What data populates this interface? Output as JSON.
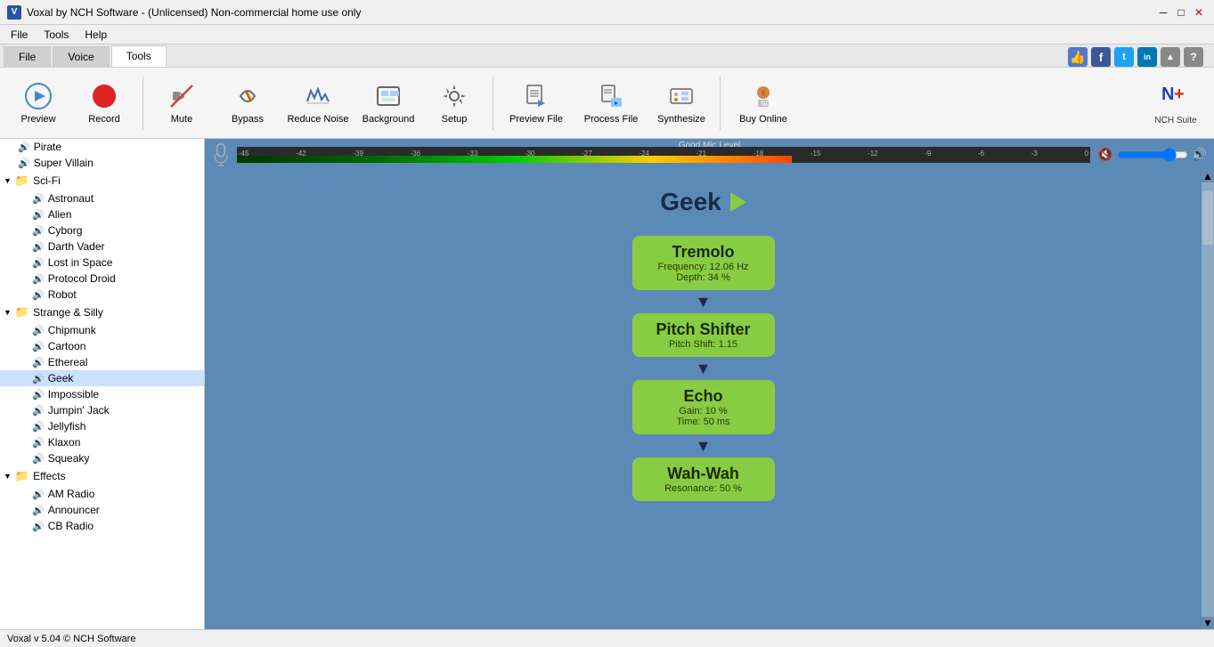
{
  "titlebar": {
    "icon_text": "V",
    "title": "Voxal by NCH Software - (Unlicensed) Non-commercial home use only",
    "btn_minimize": "─",
    "btn_maximize": "□",
    "btn_close": "✕"
  },
  "menubar": {
    "items": [
      "File",
      "Tools",
      "Help"
    ]
  },
  "tabs": {
    "items": [
      {
        "label": "File",
        "active": false
      },
      {
        "label": "Voice",
        "active": false
      },
      {
        "label": "Tools",
        "active": true
      }
    ]
  },
  "toolbar": {
    "buttons": [
      {
        "name": "preview",
        "label": "Preview"
      },
      {
        "name": "record",
        "label": "Record"
      },
      {
        "name": "mute",
        "label": "Mute"
      },
      {
        "name": "bypass",
        "label": "Bypass"
      },
      {
        "name": "reduce-noise",
        "label": "Reduce Noise"
      },
      {
        "name": "background",
        "label": "Background"
      },
      {
        "name": "setup",
        "label": "Setup"
      },
      {
        "name": "preview-file",
        "label": "Preview File"
      },
      {
        "name": "process-file",
        "label": "Process File"
      },
      {
        "name": "synthesize",
        "label": "Synthesize"
      },
      {
        "name": "buy-online",
        "label": "Buy Online"
      }
    ],
    "nch_suite_label": "NCH Suite"
  },
  "social": {
    "icons": [
      {
        "label": "👍",
        "bg": "#3355aa"
      },
      {
        "label": "f",
        "bg": "#3b5998"
      },
      {
        "label": "t",
        "bg": "#1da1f2"
      },
      {
        "label": "in",
        "bg": "#0077b5"
      },
      {
        "label": "▲",
        "bg": "#888"
      },
      {
        "label": "?",
        "bg": "#888"
      }
    ]
  },
  "mic_level": {
    "label": "Good Mic Level",
    "ticks": [
      "-45",
      "-42",
      "-39",
      "-36",
      "-33",
      "-30",
      "-27",
      "-24",
      "-21",
      "-18",
      "-15",
      "-12",
      "-9",
      "-6",
      "-3",
      "0"
    ]
  },
  "sidebar": {
    "items_before_scifi": [
      {
        "label": "Pirate",
        "indent": 1,
        "type": "voice"
      },
      {
        "label": "Super Villain",
        "indent": 1,
        "type": "voice"
      }
    ],
    "folder_scifi": "Sci-Fi",
    "scifi_items": [
      {
        "label": "Astronaut"
      },
      {
        "label": "Alien"
      },
      {
        "label": "Cyborg"
      },
      {
        "label": "Darth Vader"
      },
      {
        "label": "Lost in Space"
      },
      {
        "label": "Protocol Droid"
      },
      {
        "label": "Robot"
      }
    ],
    "folder_strange": "Strange & Silly",
    "strange_items": [
      {
        "label": "Chipmunk"
      },
      {
        "label": "Cartoon"
      },
      {
        "label": "Ethereal"
      },
      {
        "label": "Geek",
        "selected": true
      },
      {
        "label": "Impossible"
      },
      {
        "label": "Jumpin' Jack"
      },
      {
        "label": "Jellyfish"
      },
      {
        "label": "Klaxon"
      },
      {
        "label": "Squeaky"
      }
    ],
    "folder_effects": "Effects",
    "effects_items": [
      {
        "label": "AM Radio"
      },
      {
        "label": "Announcer"
      },
      {
        "label": "CB Radio"
      }
    ]
  },
  "voice_display": {
    "name": "Geek",
    "effects": [
      {
        "name": "Tremolo",
        "params": [
          "Frequency: 12.06 Hz",
          "Depth: 34 %"
        ]
      },
      {
        "name": "Pitch Shifter",
        "params": [
          "Pitch Shift: 1.15"
        ]
      },
      {
        "name": "Echo",
        "params": [
          "Gain: 10 %",
          "Time: 50 ms"
        ]
      },
      {
        "name": "Wah-Wah",
        "params": [
          "Resonance: 50 %"
        ]
      }
    ]
  },
  "statusbar": {
    "text": "Voxal v 5.04 © NCH Software"
  }
}
